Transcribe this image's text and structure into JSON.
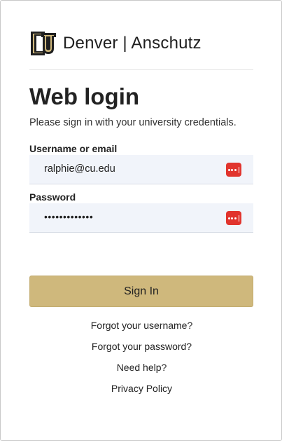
{
  "brand": {
    "name": "Denver | Anschutz",
    "logo_icon": "cu-logo-icon",
    "colors": {
      "gold": "#cfb87c",
      "black": "#1f1f1f"
    }
  },
  "heading": {
    "title": "Web login",
    "subtitle": "Please sign in with your university credentials."
  },
  "form": {
    "username": {
      "label": "Username or email",
      "value": "ralphie@cu.edu",
      "icon": "password-manager-icon"
    },
    "password": {
      "label": "Password",
      "value": "•••••••••••••",
      "icon": "password-manager-icon"
    },
    "submit_label": "Sign In"
  },
  "links": {
    "forgot_username": "Forgot your username?",
    "forgot_password": "Forgot your password?",
    "help": "Need help?",
    "privacy": "Privacy Policy"
  },
  "colors": {
    "accent": "#cfb87c",
    "field_bg": "#f1f4fa",
    "pm_icon": "#e1342d"
  }
}
